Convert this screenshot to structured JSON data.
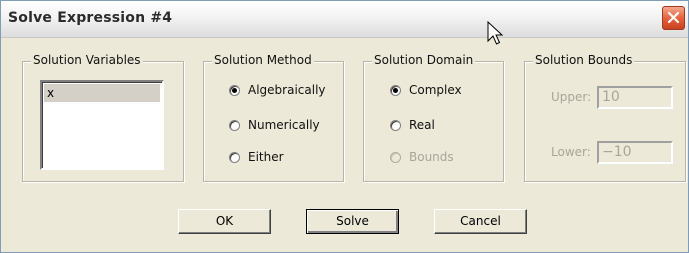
{
  "window": {
    "title": "Solve Expression #4"
  },
  "solution_variables": {
    "legend": "Solution Variables",
    "items": [
      "x"
    ],
    "selected": "x"
  },
  "solution_method": {
    "legend": "Solution Method",
    "options": [
      {
        "label": "Algebraically",
        "checked": true
      },
      {
        "label": "Numerically",
        "checked": false
      },
      {
        "label": "Either",
        "checked": false
      }
    ]
  },
  "solution_domain": {
    "legend": "Solution Domain",
    "options": [
      {
        "label": "Complex",
        "checked": true
      },
      {
        "label": "Real",
        "checked": false
      },
      {
        "label": "Bounds",
        "checked": false,
        "disabled": true
      }
    ]
  },
  "solution_bounds": {
    "legend": "Solution Bounds",
    "upper_label": "Upper:",
    "upper_value": "10",
    "lower_label": "Lower:",
    "lower_value": "−10"
  },
  "buttons": {
    "ok": "OK",
    "solve": "Solve",
    "cancel": "Cancel"
  },
  "icons": {
    "close": "close-icon",
    "cursor": "mouse-pointer-icon"
  },
  "colors": {
    "close_button": "#e5633e",
    "dialog_background": "#ece9d8"
  }
}
